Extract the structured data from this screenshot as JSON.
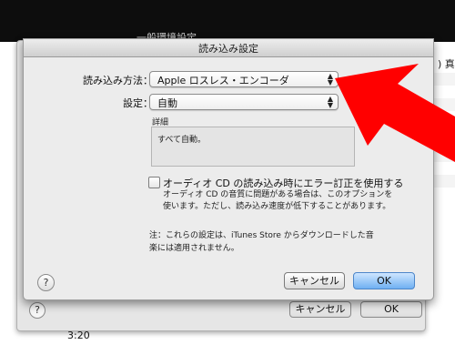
{
  "background_window": {
    "title": "一般環境設定",
    "right_glyph": ") 真",
    "help_label": "?",
    "cancel_label": "キャンセル",
    "ok_label": "OK",
    "time_text": "3:20"
  },
  "dialog": {
    "title": "読み込み設定",
    "import_method_label": "読み込み方法：",
    "import_method_value": "Apple ロスレス・エンコーダ",
    "setting_label": "設定：",
    "setting_value": "自動",
    "details_label": "詳細",
    "details_text": "すべて自動。",
    "error_correction_label": "オーディオ CD の読み込み時にエラー訂正を使用する",
    "error_correction_desc_line1": "オーディオ CD の音質に問題がある場合は、このオプションを",
    "error_correction_desc_line2": "使います。ただし、読み込み速度が低下することがあります。",
    "note_line1": "注：これらの設定は、iTunes Store からダウンロードした音",
    "note_line2": "楽には適用されません。",
    "help_label": "?",
    "cancel_label": "キャンセル",
    "ok_label": "OK"
  },
  "colors": {
    "accent_button": "#6fb0f2",
    "annotation_arrow": "#ff0000"
  }
}
